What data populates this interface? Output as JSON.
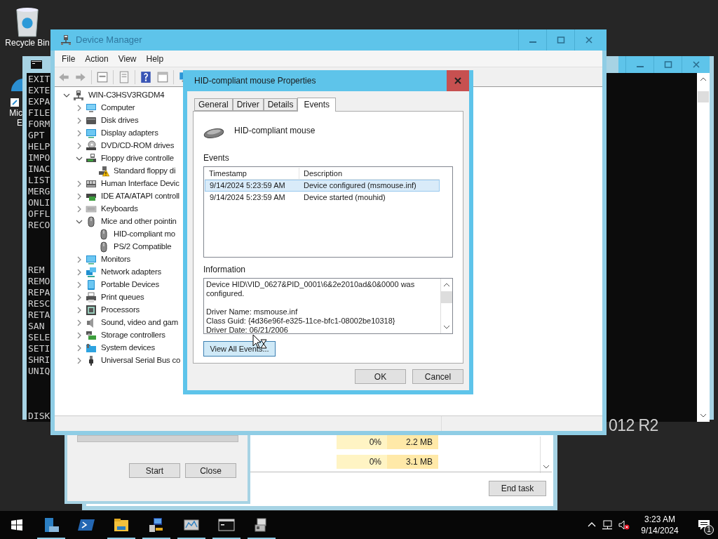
{
  "desktop": {
    "icons": [
      {
        "kind": "recycle_bin",
        "label_lines": [
          "Recycle Bin"
        ]
      },
      {
        "kind": "shortcut",
        "label_lines": [
          "Mic",
          "E"
        ]
      }
    ],
    "edition_text": "012 R2"
  },
  "console_window": {
    "line_groups": [
      [
        "EXIT",
        "EXTE",
        "EXPA",
        "FILE",
        "FORM",
        "GPT",
        "HELP",
        "IMPO",
        "INAC",
        "LIST",
        "MERG",
        "ONLI",
        "OFFL",
        "RECO"
      ],
      [
        "REM",
        "REMO",
        "REPA",
        "RESC",
        "RETA",
        "SAN",
        "SELE",
        "SETI",
        "SHRI",
        "UNIQ"
      ],
      [
        "DISK"
      ]
    ]
  },
  "device_manager": {
    "title": "Device Manager",
    "menu": [
      "File",
      "Action",
      "View",
      "Help"
    ],
    "tree": {
      "label": "WIN-C3HSV3RGDM4",
      "kind": "server",
      "expanded": true,
      "children": [
        {
          "label": "Computer",
          "kind": "computer",
          "expanded": false
        },
        {
          "label": "Disk drives",
          "kind": "disk",
          "expanded": false
        },
        {
          "label": "Display adapters",
          "kind": "display",
          "expanded": false
        },
        {
          "label": "DVD/CD-ROM drives",
          "kind": "dvd",
          "expanded": false
        },
        {
          "label": "Floppy drive controlle",
          "kind": "floppy",
          "expanded": true,
          "children": [
            {
              "label": "Standard floppy di",
              "kind": "floppy_warning"
            }
          ]
        },
        {
          "label": "Human Interface Devic",
          "kind": "hid",
          "expanded": false
        },
        {
          "label": "IDE ATA/ATAPI controll",
          "kind": "ide",
          "expanded": false
        },
        {
          "label": "Keyboards",
          "kind": "keyboard",
          "expanded": false
        },
        {
          "label": "Mice and other pointin",
          "kind": "mouse",
          "expanded": true,
          "children": [
            {
              "label": "HID-compliant mo",
              "kind": "mouse"
            },
            {
              "label": "PS/2 Compatible",
              "kind": "mouse"
            }
          ]
        },
        {
          "label": "Monitors",
          "kind": "display",
          "expanded": false
        },
        {
          "label": "Network adapters",
          "kind": "network",
          "expanded": false
        },
        {
          "label": "Portable Devices",
          "kind": "portable",
          "expanded": false
        },
        {
          "label": "Print queues",
          "kind": "printer",
          "expanded": false
        },
        {
          "label": "Processors",
          "kind": "processor",
          "expanded": false
        },
        {
          "label": "Sound, video and gam",
          "kind": "sound",
          "expanded": false
        },
        {
          "label": "Storage controllers",
          "kind": "storage",
          "expanded": false
        },
        {
          "label": "System devices",
          "kind": "system",
          "expanded": false
        },
        {
          "label": "Universal Serial Bus co",
          "kind": "usb",
          "expanded": false
        }
      ]
    }
  },
  "properties_dialog": {
    "title": "HID-compliant mouse Properties",
    "tabs": [
      {
        "label": "General",
        "selected": false
      },
      {
        "label": "Driver",
        "selected": false
      },
      {
        "label": "Details",
        "selected": false
      },
      {
        "label": "Events",
        "selected": true
      }
    ],
    "device_name": "HID-compliant mouse",
    "events_label": "Events",
    "columns": [
      "Timestamp",
      "Description"
    ],
    "rows": [
      {
        "timestamp": "9/14/2024 5:23:59 AM",
        "description": "Device configured (msmouse.inf)",
        "selected": true
      },
      {
        "timestamp": "9/14/2024 5:23:59 AM",
        "description": "Device started (mouhid)",
        "selected": false
      }
    ],
    "information_label": "Information",
    "information": [
      [
        "Device HID\\VID_0627&PID_0001\\6&2e2010ad&0&0000 was configured."
      ],
      [
        "Driver Name: msmouse.inf",
        "Class Guid: {4d36e96f-e325-11ce-bfc1-08002be10318}",
        "Driver Date: 06/21/2006"
      ]
    ],
    "view_all_button": {
      "label": "View All Events...",
      "hovered": true
    },
    "buttons": [
      "OK",
      "Cancel"
    ]
  },
  "service_dialog": {
    "buttons": [
      "Start",
      "Close"
    ]
  },
  "task_manager": {
    "rows": [
      {
        "cpu": "0%",
        "memory": "2.2 MB"
      },
      {
        "cpu": "0%",
        "memory": "3.1 MB"
      }
    ],
    "end_task_button": "End task"
  },
  "taskbar": {
    "apps": [
      {
        "kind": "server_manager",
        "running": true
      },
      {
        "kind": "powershell",
        "running": false
      },
      {
        "kind": "explorer",
        "running": true
      },
      {
        "kind": "network_app",
        "running": true
      },
      {
        "kind": "monitor_app",
        "running": true
      },
      {
        "kind": "console",
        "running": true
      },
      {
        "kind": "device_app",
        "running": true
      }
    ],
    "clock": {
      "time": "3:23 AM",
      "date": "9/14/2024"
    },
    "notification_count": "1"
  }
}
